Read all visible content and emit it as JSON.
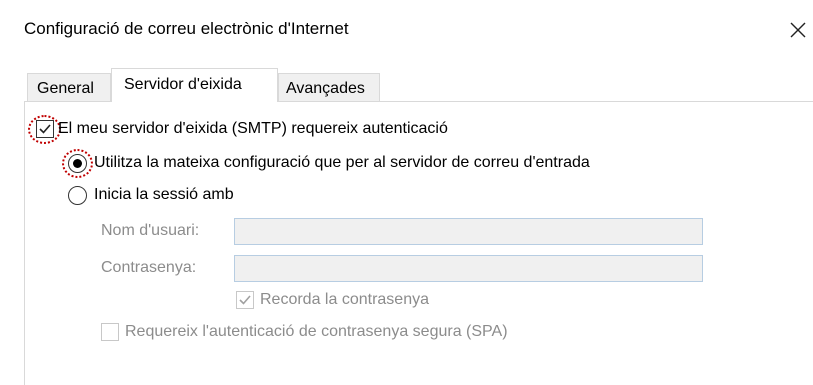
{
  "dialog": {
    "title": "Configuració de correu electrònic d'Internet"
  },
  "tabs": [
    {
      "label": "General",
      "active": false
    },
    {
      "label": "Servidor d'eixida",
      "active": true
    },
    {
      "label": "Avançades",
      "active": false
    }
  ],
  "outgoing": {
    "requires_auth_label": "El meu servidor d'eixida (SMTP) requereix autenticació",
    "requires_auth_checked": true,
    "same_settings_label": "Utilitza la mateixa configuració que per al servidor de correu d'entrada",
    "same_settings_selected": true,
    "logon_label": "Inicia la sessió amb",
    "logon_selected": false,
    "username_label": "Nom d'usuari:",
    "username_value": "",
    "password_label": "Contrasenya:",
    "password_value": "",
    "remember_password_label": "Recorda la contrasenya",
    "remember_password_checked": true,
    "spa_label": "Requereix l'autenticació de contrasenya segura (SPA)",
    "spa_checked": false
  },
  "colors": {
    "focus_ring": "#c00000",
    "disabled_text": "#8c8c8c",
    "disabled_field_border": "#b7cde2",
    "tab_border": "#d9d9d9"
  }
}
